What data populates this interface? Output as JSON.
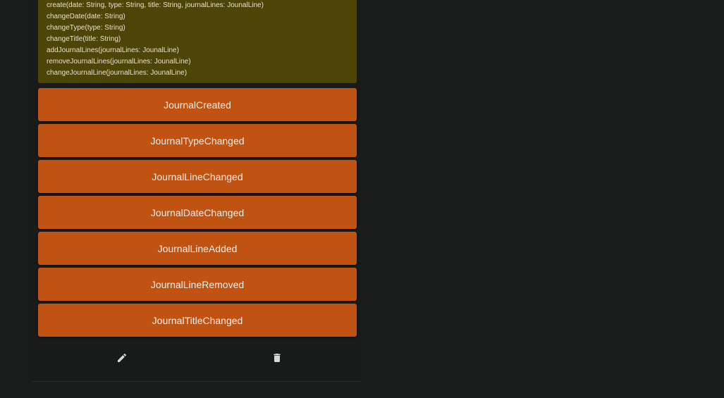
{
  "aggregate": {
    "commands": [
      "create(date: String, type: String, title: String, journalLines: JounalLine)",
      "changeDate(date: String)",
      "changeType(type: String)",
      "changeTitle(title: String)",
      "addJournalLines(journalLines: JounalLine)",
      "removeJournalLines(journalLines: JounalLine)",
      "changeJournalLine(journalLines: JounalLine)"
    ]
  },
  "events": [
    "JournalCreated",
    "JournalTypeChanged",
    "JournalLineChanged",
    "JournalDateChanged",
    "JournalLineAdded",
    "JournalLineRemoved",
    "JournalTitleChanged"
  ],
  "actions": {
    "edit_icon": "pencil-icon",
    "delete_icon": "trash-icon"
  },
  "colors": {
    "background": "#1a1b1b",
    "aggregate": "#4d4505",
    "event": "#c05212",
    "icon": "#d8d8d8"
  }
}
